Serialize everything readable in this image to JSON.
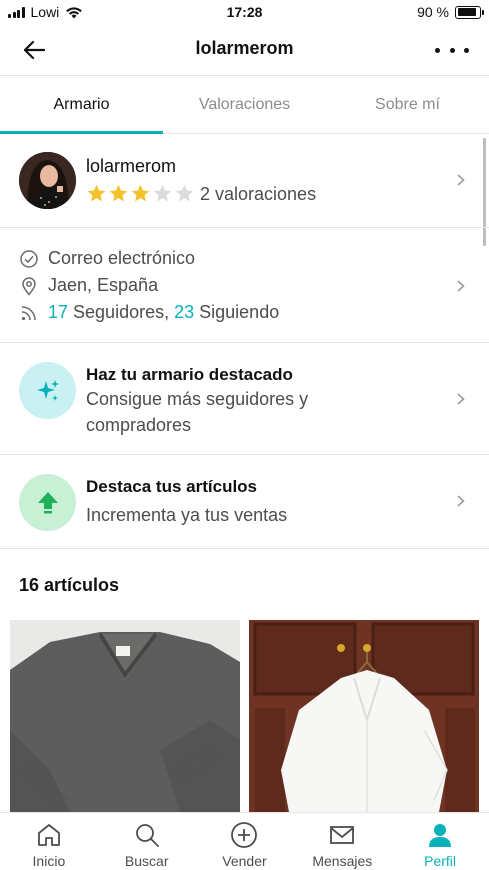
{
  "status": {
    "carrier": "Lowi",
    "time": "17:28",
    "battery": "90 %"
  },
  "header": {
    "title": "lolarmerom"
  },
  "tabs": [
    {
      "label": "Armario",
      "active": true
    },
    {
      "label": "Valoraciones",
      "active": false
    },
    {
      "label": "Sobre mí",
      "active": false
    }
  ],
  "profile": {
    "username": "lolarmerom",
    "rating_stars": 3,
    "rating_max": 5,
    "rating_text": "2 valoraciones"
  },
  "info": {
    "email": "Correo electrónico",
    "location": "Jaen, España",
    "followers_count": "17",
    "followers_label": "Seguidores,",
    "following_count": "23",
    "following_label": "Siguiendo"
  },
  "promo_wardrobe": {
    "title": "Haz tu armario destacado",
    "subtitle": "Consigue más seguidores y compradores",
    "icon": "sparkle-icon"
  },
  "promo_items": {
    "title": "Destaca tus artículos",
    "subtitle": "Incrementa ya tus ventas",
    "icon": "arrow-up-icon"
  },
  "items": {
    "count_label": "16 artículos"
  },
  "bottom_nav": [
    {
      "label": "Inicio",
      "icon": "home-icon",
      "active": false
    },
    {
      "label": "Buscar",
      "icon": "search-icon",
      "active": false
    },
    {
      "label": "Vender",
      "icon": "plus-circle-icon",
      "active": false
    },
    {
      "label": "Mensajes",
      "icon": "mail-icon",
      "active": false
    },
    {
      "label": "Perfil",
      "icon": "profile-icon",
      "active": true
    }
  ],
  "colors": {
    "accent": "#09b1ba",
    "star": "#f4c22b",
    "star_empty": "#dcdcdc",
    "green_circle": "#c8f0d4",
    "teal_circle": "#c9f0f2"
  }
}
